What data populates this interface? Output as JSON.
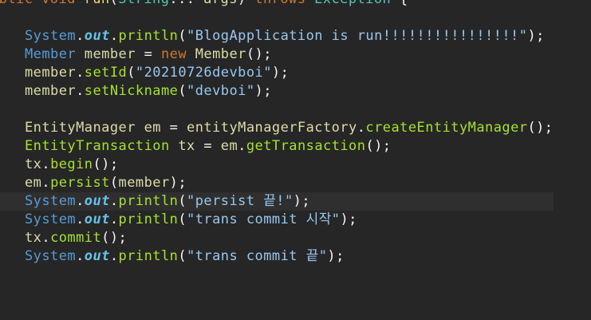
{
  "colors": {
    "background": "#262626",
    "current_line": "#2f2f2f",
    "keyword": "#cc7832",
    "type": "#4ec9b0",
    "variable": "#dcdcaa",
    "field": "#66c2e8",
    "method": "#a6e22e",
    "string": "#98c8f0"
  },
  "code": {
    "sig": {
      "p1": "ublic void ",
      "p2": "run",
      "p3": "(",
      "p4": "String",
      "p5": "... ",
      "p6": "args",
      "p7": ") ",
      "p8": "throws ",
      "p9": "Exception",
      "p10": " {"
    },
    "l1": {
      "a": "System",
      "b": ".",
      "c": "out",
      "d": ".",
      "e": "println",
      "f": "(",
      "g": "\"BlogApplication is run!!!!!!!!!!!!!!!!\"",
      "h": ");"
    },
    "l2": {
      "a": "Member",
      "b": " ",
      "c": "member",
      "d": " = ",
      "e": "new",
      "f": " ",
      "g": "Member",
      "h": "();"
    },
    "l3": {
      "a": "member",
      "b": ".",
      "c": "setId",
      "d": "(",
      "e": "\"20210726devboi\"",
      "f": ");"
    },
    "l4": {
      "a": "member",
      "b": ".",
      "c": "setNickname",
      "d": "(",
      "e": "\"devboi\"",
      "f": ");"
    },
    "l5": {
      "a": "EntityManager",
      "b": " ",
      "c": "em",
      "d": " = ",
      "e": "entityManagerFactory",
      "f": ".",
      "g": "createEntityManager",
      "h": "();"
    },
    "l6": {
      "a": "EntityTransaction",
      "b": " ",
      "c": "tx",
      "d": " = ",
      "e": "em",
      "f": ".",
      "g": "getTransaction",
      "h": "();"
    },
    "l7": {
      "a": "tx",
      "b": ".",
      "c": "begin",
      "d": "();"
    },
    "l8": {
      "a": "em",
      "b": ".",
      "c": "persist",
      "d": "(",
      "e": "member",
      "f": ");"
    },
    "l9": {
      "a": "System",
      "b": ".",
      "c": "out",
      "d": ".",
      "e": "println",
      "f": "(",
      "g": "\"persist 끝!\"",
      "h": ");"
    },
    "l10": {
      "a": "System",
      "b": ".",
      "c": "out",
      "d": ".",
      "e": "println",
      "f": "(",
      "g": "\"trans commit 시작\"",
      "h": ");"
    },
    "l11": {
      "a": "tx",
      "b": ".",
      "c": "commit",
      "d": "();"
    },
    "l12": {
      "a": "System",
      "b": ".",
      "c": "out",
      "d": ".",
      "e": "println",
      "f": "(",
      "g": "\"trans commit 끝\"",
      "h": ");"
    }
  }
}
